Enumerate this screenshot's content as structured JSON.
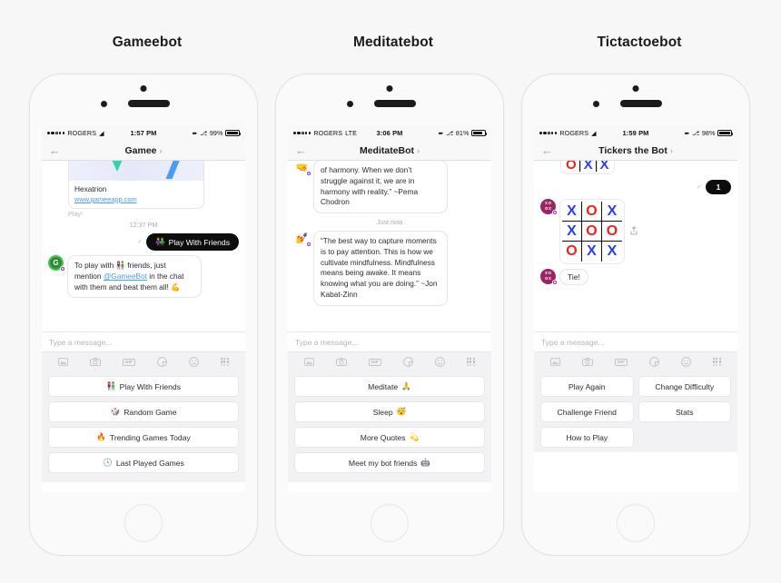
{
  "page": {
    "background": "#f7f7f7"
  },
  "phones": [
    {
      "caption": "Gameebot",
      "status": {
        "carrier": "ROGERS",
        "network": "wifi",
        "time": "1:57 PM",
        "battery_pct": "99%",
        "location_icon": "location-arrow-icon",
        "bluetooth_icon": "bluetooth-icon"
      },
      "nav": {
        "back_icon": "back-arrow-icon",
        "title": "Gamee",
        "chevron": "›"
      },
      "chat": {
        "game_card": {
          "title": "Hexatrion",
          "url": "www.gameeapp.com",
          "play_label": "Play!"
        },
        "timestamp": "12:37 PM",
        "outgoing": {
          "delivered_icon": "delivered-check-icon",
          "emoji": "👫",
          "text": "Play With Friends"
        },
        "incoming": {
          "avatar": "gamee-bot-avatar",
          "text_part1": "To play with ",
          "emoji1": "👫",
          "text_part2": " friends, just mention ",
          "mention": "@GameeBot",
          "text_part3": " in the chat with them and beat them all! ",
          "emoji2": "💪"
        }
      },
      "composer": {
        "placeholder": "Type a message..."
      },
      "toolbar": [
        "photo-icon",
        "camera-icon",
        "gif-icon",
        "sticker-icon",
        "emoji-icon",
        "apps-grid-icon"
      ],
      "menu_layout": "list",
      "menu": [
        {
          "emoji": "👫",
          "label": "Play With Friends"
        },
        {
          "emoji": "🎲",
          "label": "Random Game"
        },
        {
          "emoji": "🔥",
          "label": "Trending Games Today"
        },
        {
          "emoji": "🕓",
          "label": "Last Played Games"
        }
      ]
    },
    {
      "caption": "Meditatebot",
      "status": {
        "carrier": "ROGERS",
        "network": "LTE",
        "time": "3:06 PM",
        "battery_pct": "81%",
        "location_icon": "location-arrow-icon",
        "bluetooth_icon": "bluetooth-icon"
      },
      "nav": {
        "back_icon": "back-arrow-icon",
        "title": "MeditateBot",
        "chevron": "›"
      },
      "chat": {
        "quote1": {
          "avatar": "meditation-hand-avatar",
          "text": "of harmony. When we don’t struggle against it, we are in harmony with reality.” ~Pema Chodron"
        },
        "timestamp": "Just now",
        "quote2": {
          "avatar": "meditation-yoga-avatar",
          "text": "“The best way to capture moments is to pay attention. This is how we cultivate mindfulness. Mindfulness means being awake. It means knowing what you are doing.” ~Jon Kabat-Zinn"
        }
      },
      "composer": {
        "placeholder": "Type a message..."
      },
      "toolbar": [
        "photo-icon",
        "camera-icon",
        "gif-icon",
        "sticker-icon",
        "emoji-icon",
        "apps-grid-icon"
      ],
      "menu_layout": "list",
      "menu": [
        {
          "label": "Meditate",
          "emoji": "🙏"
        },
        {
          "label": "Sleep",
          "emoji": "😴"
        },
        {
          "label": "More Quotes",
          "emoji": "💫"
        },
        {
          "label": "Meet my bot friends",
          "emoji": "🤖"
        }
      ]
    },
    {
      "caption": "Tictactoebot",
      "status": {
        "carrier": "ROGERS",
        "network": "wifi",
        "time": "1:59 PM",
        "battery_pct": "98%",
        "location_icon": "location-arrow-icon",
        "bluetooth_icon": "bluetooth-icon"
      },
      "nav": {
        "back_icon": "back-arrow-icon",
        "title": "Tickers the Bot",
        "chevron": "›"
      },
      "chat": {
        "strip": [
          "O",
          "X",
          "X"
        ],
        "badge": {
          "delivered_icon": "delivered-check-icon",
          "count": "1"
        },
        "board": {
          "avatar": "tictactoe-bot-avatar",
          "cells": [
            "X",
            "O",
            "X",
            "X",
            "O",
            "O",
            "O",
            "X",
            "X"
          ],
          "share_icon": "share-icon"
        },
        "result": {
          "avatar": "tictactoe-bot-avatar",
          "text": "Tie!"
        }
      },
      "composer": {
        "placeholder": "Type a message..."
      },
      "toolbar": [
        "photo-icon",
        "camera-icon",
        "gif-icon",
        "sticker-icon",
        "emoji-icon",
        "apps-grid-icon"
      ],
      "menu_layout": "grid",
      "menu": [
        {
          "label": "Play Again"
        },
        {
          "label": "Change Difficulty"
        },
        {
          "label": "Challenge Friend"
        },
        {
          "label": "Stats"
        },
        {
          "label": "How to Play"
        }
      ]
    }
  ],
  "colors": {
    "mark_x": "#2b3ff0",
    "mark_o": "#ef2020",
    "link": "#4a9df0",
    "dark_bubble": "#0d0d0d",
    "menu_bg": "#f2f2f5"
  }
}
